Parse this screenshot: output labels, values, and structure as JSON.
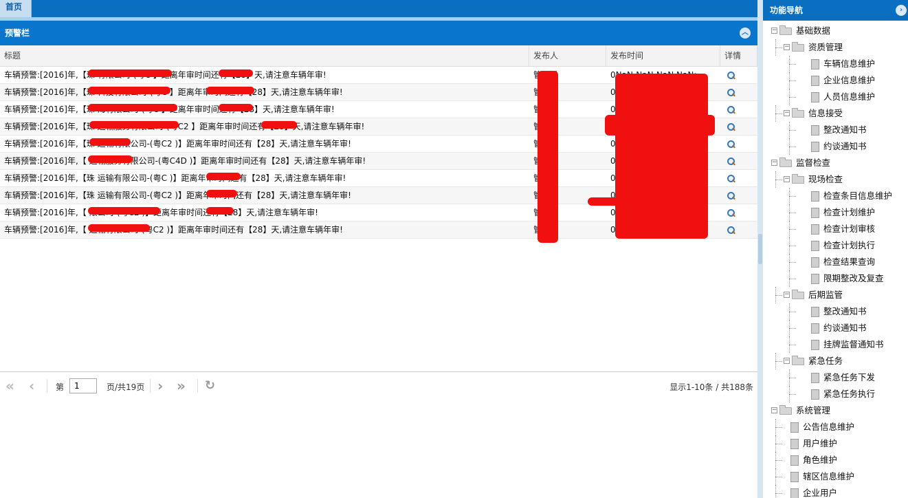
{
  "tabs": {
    "home": "首页"
  },
  "panel": {
    "title": "预警栏"
  },
  "grid": {
    "headers": {
      "title": "标题",
      "publisher": "发布人",
      "time": "发布时间",
      "detail": "详情"
    },
    "rows": [
      {
        "title": "车辆预警:[2016]年,【珠                    有限公司-(粤C          】距离年审时间还有【28】天,请注意车辆年审!",
        "publisher": "管理员",
        "time": "0NaN-NaN-NaN NaN:..."
      },
      {
        "title": "车辆预警:[2016]年,【珠               科技有限公司-(粤C          】距离年审时间还有【28】天,请注意车辆年审!",
        "publisher": "管理员",
        "time": "0NaN-NaN-NaN NaN:..."
      },
      {
        "title": "车辆预警:[2016]年,【珠               海有限公司-(粤C          】距离年审时间还有【28】天,请注意车辆年审!",
        "publisher": "管理员",
        "time": "0NaN-NaN-NaN NaN:..."
      },
      {
        "title": "车辆预警:[2016]年,【珠                运输服务有限公司-(粤C2          】距离年审时间还有【28】天,请注意车辆年审!",
        "publisher": "管理员",
        "time": "0NaN-NaN-NaN NaN:..."
      },
      {
        "title": "车辆预警:[2016]年,【珠            运输有限公司-(粤C2      )】距离年审时间还有【28】天,请注意车辆年审!",
        "publisher": "管理员",
        "time": "0NaN-NaN-NaN NaN:..."
      },
      {
        "title": "车辆预警:[2016]年,【            运输服务有限公司-(粤C4D     )】距离年审时间还有【28】天,请注意车辆年审!",
        "publisher": "管理员",
        "time": "0NaN-NaN-NaN NaN:..."
      },
      {
        "title": "车辆预警:[2016]年,【珠          运输有限公司-(粤C          )】距离年审时间还有【28】天,请注意车辆年审!",
        "publisher": "管理员",
        "time": "0NaN-NaN-NaN NaN:..."
      },
      {
        "title": "车辆预警:[2016]年,【珠          运输有限公司-(粤C2         )】距离年审时间还有【28】天,请注意车辆年审!",
        "publisher": "管理员",
        "time": "0NaN-NaN-NaN NaN:..."
      },
      {
        "title": "车辆预警:[2016]年,【            限公司-(粤C2        )】距离年审时间还有【28】天,请注意车辆年审!",
        "publisher": "管理员",
        "time": "0NaN-NaN-NaN NaN:..."
      },
      {
        "title": "车辆预警:[2016]年,【          运输有限公司-(粤C2        )】距离年审时间还有【28】天,请注意车辆年审!",
        "publisher": "管理员",
        "time": "0NaN-NaN-NaN NaN:..."
      }
    ]
  },
  "pager": {
    "page_prefix": "第",
    "page_value": "1",
    "page_suffix": "页/共19页",
    "summary": "显示1-10条 / 共188条"
  },
  "sidebar": {
    "title": "功能导航",
    "tree": [
      {
        "label": "基础数据",
        "level": 0,
        "type": "folder"
      },
      {
        "label": "资质管理",
        "level": 1,
        "type": "folder"
      },
      {
        "label": "车辆信息维护",
        "level": 2,
        "type": "file"
      },
      {
        "label": "企业信息维护",
        "level": 2,
        "type": "file"
      },
      {
        "label": "人员信息维护",
        "level": 2,
        "type": "file"
      },
      {
        "label": "信息接受",
        "level": 1,
        "type": "folder"
      },
      {
        "label": "整改通知书",
        "level": 2,
        "type": "file"
      },
      {
        "label": "约谈通知书",
        "level": 2,
        "type": "file"
      },
      {
        "label": "监督检查",
        "level": 0,
        "type": "folder"
      },
      {
        "label": "现场检查",
        "level": 1,
        "type": "folder"
      },
      {
        "label": "检查条目信息维护",
        "level": 2,
        "type": "file"
      },
      {
        "label": "检查计划维护",
        "level": 2,
        "type": "file"
      },
      {
        "label": "检查计划审核",
        "level": 2,
        "type": "file"
      },
      {
        "label": "检查计划执行",
        "level": 2,
        "type": "file"
      },
      {
        "label": "检查结果查询",
        "level": 2,
        "type": "file"
      },
      {
        "label": "限期整改及复查",
        "level": 2,
        "type": "file"
      },
      {
        "label": "后期监管",
        "level": 1,
        "type": "folder"
      },
      {
        "label": "整改通知书",
        "level": 2,
        "type": "file"
      },
      {
        "label": "约谈通知书",
        "level": 2,
        "type": "file"
      },
      {
        "label": "挂牌监督通知书",
        "level": 2,
        "type": "file"
      },
      {
        "label": "紧急任务",
        "level": 1,
        "type": "folder"
      },
      {
        "label": "紧急任务下发",
        "level": 2,
        "type": "file"
      },
      {
        "label": "紧急任务执行",
        "level": 2,
        "type": "file"
      },
      {
        "label": "系统管理",
        "level": 0,
        "type": "folder"
      },
      {
        "label": "公告信息维护",
        "level": 1,
        "type": "file"
      },
      {
        "label": "用户维护",
        "level": 1,
        "type": "file"
      },
      {
        "label": "角色维护",
        "level": 1,
        "type": "file"
      },
      {
        "label": "辖区信息维护",
        "level": 1,
        "type": "file"
      },
      {
        "label": "企业用户",
        "level": 1,
        "type": "file"
      }
    ]
  },
  "colors": {
    "header_blue": "#0a6fc0",
    "redaction": "#f01010"
  },
  "icons": {
    "detail": "magnifier-icon",
    "collapse": "chevron-up-icon",
    "sidebar_toggle": "chevron-right-icon",
    "refresh": "refresh-icon"
  }
}
